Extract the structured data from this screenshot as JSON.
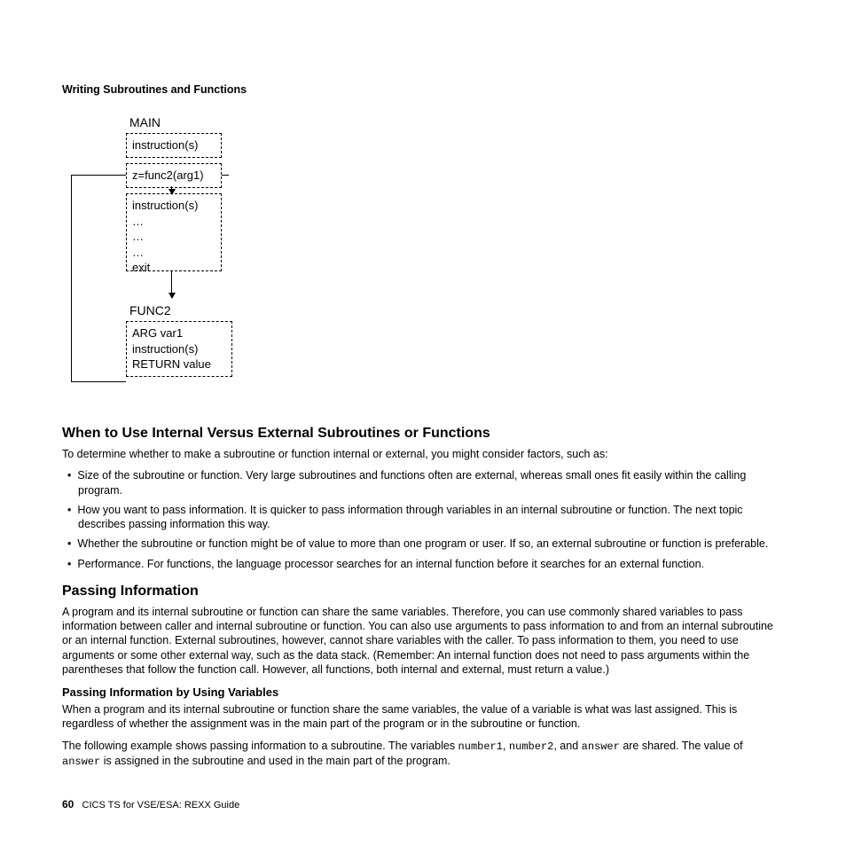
{
  "header": {
    "title": "Writing Subroutines and Functions"
  },
  "diagram": {
    "main_label": "MAIN",
    "box1_line1": "instruction(s)",
    "box2_line1": "z=func2(arg1)",
    "box3_line1": "instruction(s)",
    "box3_line2": "…",
    "box3_line3": "…",
    "box3_line4": "…",
    "box3_line5": "exit",
    "func2_label": "FUNC2",
    "box4_line1": "ARG var1",
    "box4_line2": "instruction(s)",
    "box4_line3": "RETURN value"
  },
  "section1": {
    "heading": "When to Use Internal Versus External Subroutines or Functions",
    "intro": "To determine whether to make a subroutine or function internal or external, you might consider factors, such as:",
    "bullets": [
      "Size of the subroutine or function. Very large subroutines and functions often are external, whereas small ones fit easily within the calling program.",
      "How you want to pass information. It is quicker to pass information through variables in an internal subroutine or function. The next topic describes passing information this way.",
      "Whether the subroutine or function might be of value to more than one program or user. If so, an external subroutine or function is preferable.",
      "Performance. For functions, the language processor searches for an internal function before it searches for an external function."
    ]
  },
  "section2": {
    "heading": "Passing Information",
    "para": "A program and its internal subroutine or function can share the same variables. Therefore, you can use commonly shared variables to pass information between caller and internal subroutine or function. You can also use arguments to pass information to and from an internal subroutine or an internal function. External subroutines, however, cannot share variables with the caller. To pass information to them, you need to use arguments or some other external way, such as the data stack. (Remember: An internal function does not need to pass arguments within the parentheses that follow the function call. However, all functions, both internal and external, must return a value.)"
  },
  "section3": {
    "heading": "Passing Information by Using Variables",
    "para1": "When a program and its internal subroutine or function share the same variables, the value of a variable is what was last assigned. This is regardless of whether the assignment was in the main part of the program or in the subroutine or function.",
    "para2_a": "The following example shows passing information to a subroutine. The variables ",
    "code1": "number1",
    "para2_b": ", ",
    "code2": "number2",
    "para2_c": ", and ",
    "code3": "answer",
    "para2_d": " are shared. The value of ",
    "code4": "answer",
    "para2_e": " is assigned in the subroutine and used in the main part of the program."
  },
  "footer": {
    "page": "60",
    "text": "CICS TS for VSE/ESA: REXX Guide"
  }
}
